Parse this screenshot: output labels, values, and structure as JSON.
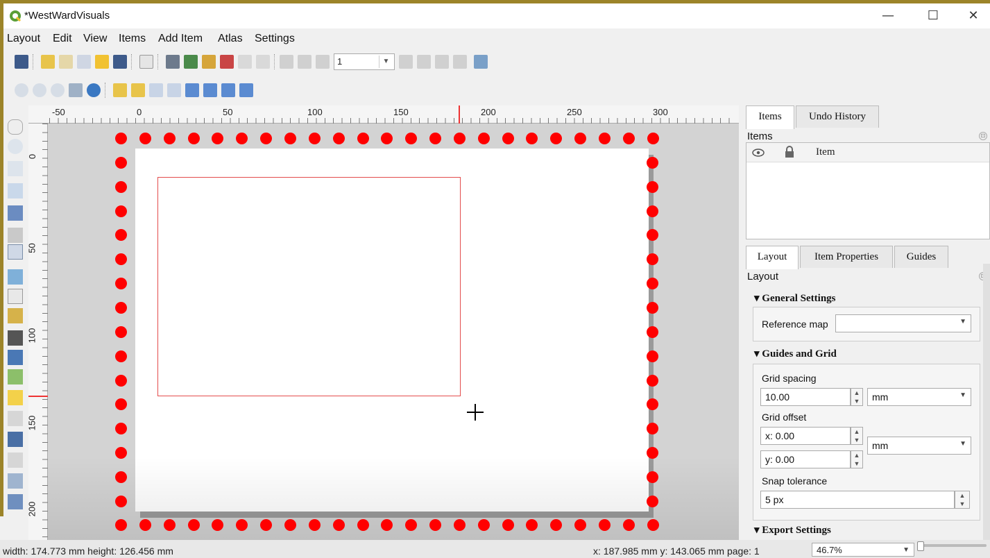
{
  "window": {
    "title": "*WestWardVisuals",
    "minimize": "—",
    "maximize": "☐",
    "close": "✕"
  },
  "menu": {
    "items": [
      {
        "label": "Layout"
      },
      {
        "label": "Edit"
      },
      {
        "label": "View"
      },
      {
        "label": "Items"
      },
      {
        "label": "Add Item"
      },
      {
        "label": "Atlas"
      },
      {
        "label": "Settings"
      }
    ]
  },
  "toolbar": {
    "page_value": "1",
    "page_dropdown": "▼"
  },
  "ruler": {
    "h_ticks": [
      "-50",
      "0",
      "50",
      "100",
      "150",
      "200",
      "250",
      "300"
    ],
    "v_ticks": [
      "0",
      "50",
      "100",
      "150",
      "200"
    ]
  },
  "right_panel": {
    "top_tabs": [
      {
        "label": "Items"
      },
      {
        "label": "Undo History"
      }
    ],
    "items_title": "Items",
    "items_col": "Item",
    "bottom_tabs": [
      {
        "label": "Layout"
      },
      {
        "label": "Item Properties"
      },
      {
        "label": "Guides"
      }
    ],
    "layout_title": "Layout",
    "general_settings": "▾ General Settings",
    "reference_map_label": "Reference map",
    "reference_map_value": "",
    "guides_grid": "▾ Guides and Grid",
    "grid_spacing_label": "Grid spacing",
    "grid_spacing_value": "10.00",
    "grid_spacing_unit": "mm",
    "grid_offset_label": "Grid offset",
    "grid_offset_x": "x: 0.00",
    "grid_offset_y": "y: 0.00",
    "grid_offset_unit": "mm",
    "snap_label": "Snap tolerance",
    "snap_value": "5 px",
    "export_settings": "▾ Export Settings"
  },
  "status": {
    "size": "width: 174.773 mm height: 126.456 mm",
    "coords": "x: 187.985 mm y: 143.065 mm page: 1",
    "zoom": "46.7%"
  }
}
